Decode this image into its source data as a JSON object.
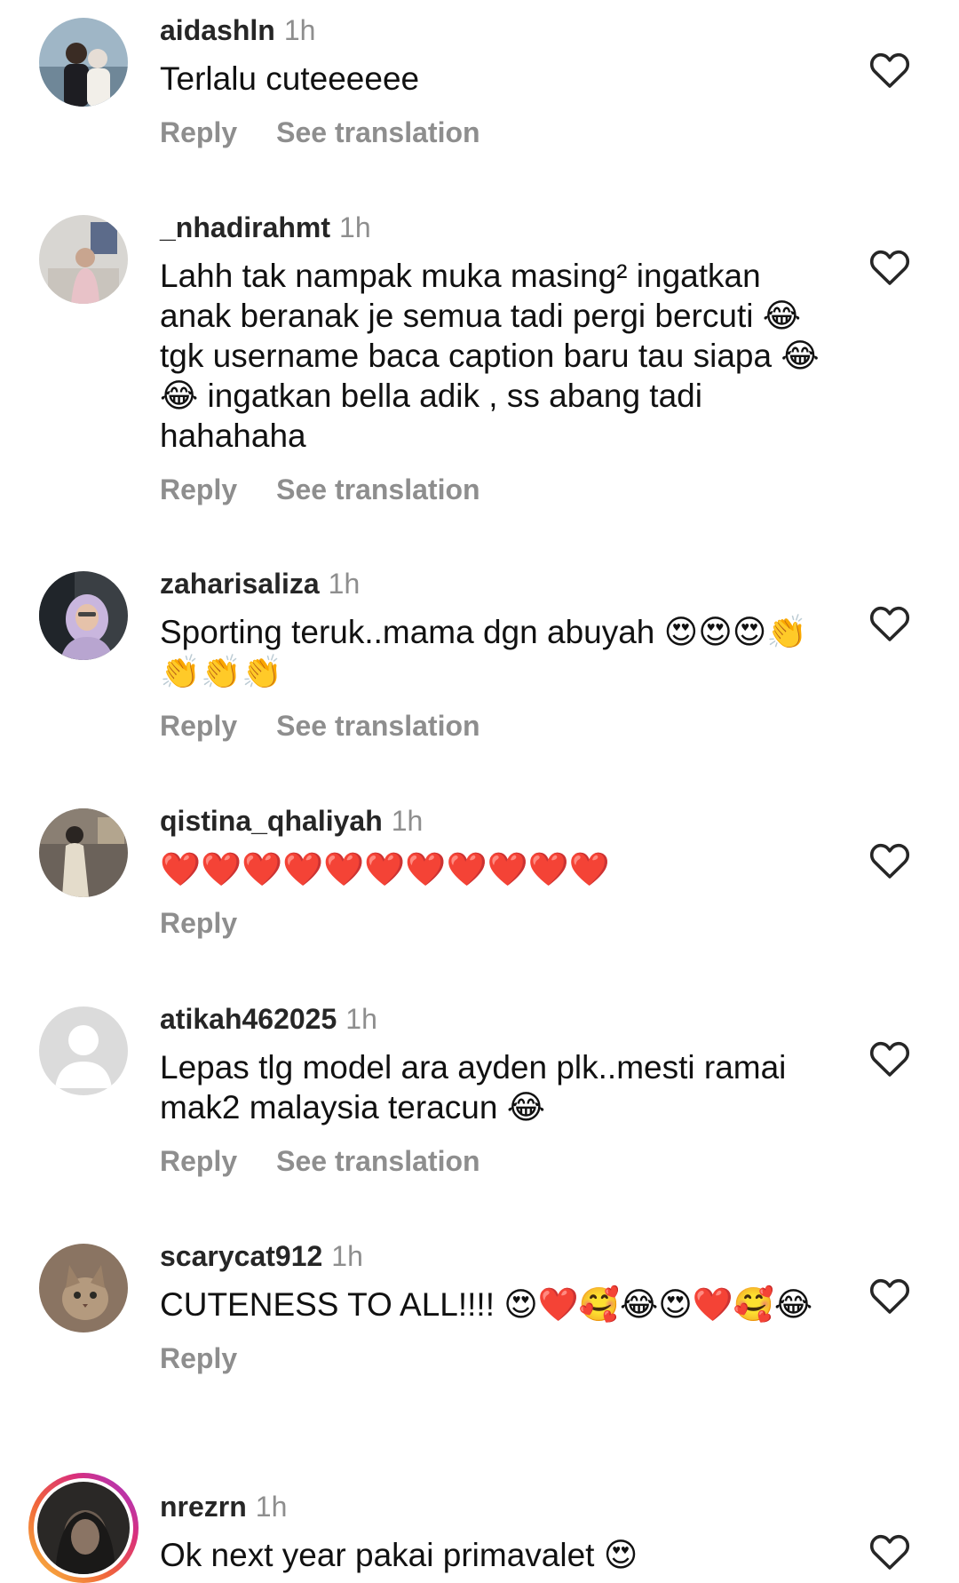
{
  "comments": [
    {
      "username": "aidashln",
      "time": "1h",
      "text": "Terlalu cuteeeeee",
      "reply_label": "Reply",
      "translation_label": "See translation",
      "avatar_icon": "person-photo-avatar"
    },
    {
      "username": "_nhadirahmt",
      "time": "1h",
      "text": "Lahh tak nampak muka masing² ingatkan anak beranak je semua tadi pergi bercuti 😂 tgk username baca caption baru tau siapa 😂😂 ingatkan bella adik , ss abang tadi hahahaha",
      "reply_label": "Reply",
      "translation_label": "See translation",
      "avatar_icon": "person-photo-avatar"
    },
    {
      "username": "zaharisaliza",
      "time": "1h",
      "text": "Sporting teruk..mama dgn abuyah 😍😍😍👏👏👏👏",
      "reply_label": "Reply",
      "translation_label": "See translation",
      "avatar_icon": "person-photo-avatar"
    },
    {
      "username": "qistina_qhaliyah",
      "time": "1h",
      "text": "❤️❤️❤️❤️❤️❤️❤️❤️❤️❤️❤️",
      "reply_label": "Reply",
      "translation_label": "",
      "avatar_icon": "person-photo-avatar"
    },
    {
      "username": "atikah462025",
      "time": "1h",
      "text": "Lepas tlg model ara ayden plk..mesti ramai mak2 malaysia teracun 😂",
      "reply_label": "Reply",
      "translation_label": "See translation",
      "avatar_icon": "default-avatar"
    },
    {
      "username": "scarycat912",
      "time": "1h",
      "text": "CUTENESS TO ALL!!!! 😍❤️🥰😂😍❤️🥰😂",
      "reply_label": "Reply",
      "translation_label": "",
      "avatar_icon": "cat-photo-avatar"
    },
    {
      "username": "nrezrn",
      "time": "1h",
      "text": "Ok next year pakai primavalet 😍",
      "reply_label": "",
      "translation_label": "",
      "avatar_icon": "story-ring-avatar"
    }
  ],
  "icons": {
    "like": "heart-outline-icon"
  },
  "colors": {
    "username": "#262626",
    "secondary": "#8e8e8e",
    "story_ring": [
      "#f9c23c",
      "#f0643b",
      "#d92f7c",
      "#9b3bd6"
    ]
  }
}
